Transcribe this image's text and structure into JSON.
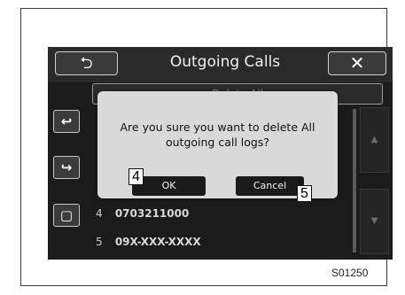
{
  "header": {
    "back_symbol": "⮌",
    "title": "Outgoing Calls",
    "close_symbol": "✕"
  },
  "sidebar": {
    "items": [
      {
        "icon": "incoming-call-icon",
        "glyph": "↩"
      },
      {
        "icon": "outgoing-call-icon",
        "glyph": "↪"
      },
      {
        "icon": "phone-device-icon",
        "glyph": "▢"
      }
    ]
  },
  "list": {
    "delete_all_label": "Delete All",
    "rows": [
      {
        "num": "4",
        "text": "0703211000"
      },
      {
        "num": "5",
        "text": "09X-XXX-XXXX"
      }
    ]
  },
  "dialog": {
    "message": "Are you sure you want to delete All outgoing call logs?",
    "ok_label": "OK",
    "cancel_label": "Cancel"
  },
  "callouts": {
    "ok_number": "4",
    "cancel_number": "5"
  },
  "figure_code": "S01250",
  "colors": {
    "screen_bg": "#1b1b1b",
    "dialog_bg": "#d9d9d9",
    "button_bg": "#1a1a1a"
  }
}
